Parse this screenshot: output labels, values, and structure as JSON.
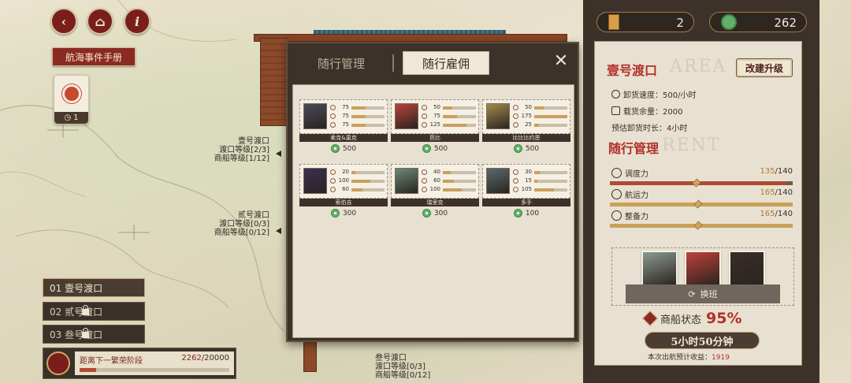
{
  "top_buttons": [
    {
      "icon": "back-icon",
      "glyph": "€"
    },
    {
      "icon": "home-icon",
      "glyph": "⌂"
    },
    {
      "icon": "info-icon",
      "glyph": "i"
    }
  ],
  "manual_button": "航海事件手册",
  "event_card": {
    "count": "1"
  },
  "map_labels": {
    "port1": [
      "壹号渡口",
      "渡口等级[2/3]",
      "商船等级[1/12]"
    ],
    "port2": [
      "贰号渡口",
      "渡口等级[0/3]",
      "商船等级[0/12]"
    ],
    "port3": [
      "叁号渡口",
      "渡口等级[0/3]",
      "商船等级[0/12]"
    ]
  },
  "port_list": [
    {
      "label": "01 壹号渡口",
      "locked": false
    },
    {
      "label": "02 贰号渡口",
      "locked": true
    },
    {
      "label": "03 叁号渡口",
      "locked": true
    }
  ],
  "prosperity": {
    "label": "距离下一繁荣阶段",
    "current": "2262",
    "total": "/20000",
    "progress": 0.1131
  },
  "modal": {
    "tabs": [
      "随行管理",
      "随行雇佣"
    ],
    "active_tab": 1,
    "mercenaries": [
      {
        "name": "柔克&巢克",
        "stats": [
          75,
          75,
          75
        ],
        "cost": "500",
        "color": "#4a4a5a"
      },
      {
        "name": "芭比",
        "stats": [
          50,
          75,
          125
        ],
        "cost": "500",
        "color": "#b8433a"
      },
      {
        "name": "比比比约恩",
        "stats": [
          50,
          175,
          25
        ],
        "cost": "500",
        "color": "#a38a4a"
      },
      {
        "name": "索伯吉",
        "stats": [
          20,
          100,
          60
        ],
        "cost": "300",
        "color": "#3b2f52"
      },
      {
        "name": "瑞里克",
        "stats": [
          40,
          60,
          100
        ],
        "cost": "300",
        "color": "#6a8a7a"
      },
      {
        "name": "多手",
        "stats": [
          30,
          15,
          105
        ],
        "cost": "100",
        "color": "#5a6a70"
      }
    ]
  },
  "resources": {
    "tickets": "2",
    "coins": "262"
  },
  "port_info": {
    "title": "壹号渡口",
    "upgrade_label": "改建升级",
    "unload_speed": "卸货速度：500/小时",
    "cargo_left": "载货余量：2000",
    "est_time": "预估卸货时长：4小时",
    "watermark1": "AREA",
    "watermark2": "RENT"
  },
  "escort": {
    "title": "随行管理",
    "stats": [
      {
        "label": "调度力",
        "cur": "135",
        "max": "/140",
        "ratio": 0.964,
        "color": "#b04a38"
      },
      {
        "label": "航运力",
        "cur": "165",
        "max": "/140",
        "ratio": 1.0,
        "color": "#c9a05a"
      },
      {
        "label": "整备力",
        "cur": "165",
        "max": "/140",
        "ratio": 1.0,
        "color": "#c9a05a"
      }
    ],
    "crew_colors": [
      "#8a9a90",
      "#c0403a",
      "#3a2e28"
    ],
    "shift_label": "换班"
  },
  "ship_status": {
    "label": "商船状态",
    "percent": "95%"
  },
  "timer": "5小时50分钟",
  "income": {
    "label": "本次出航预计收益：",
    "value": "1919"
  }
}
